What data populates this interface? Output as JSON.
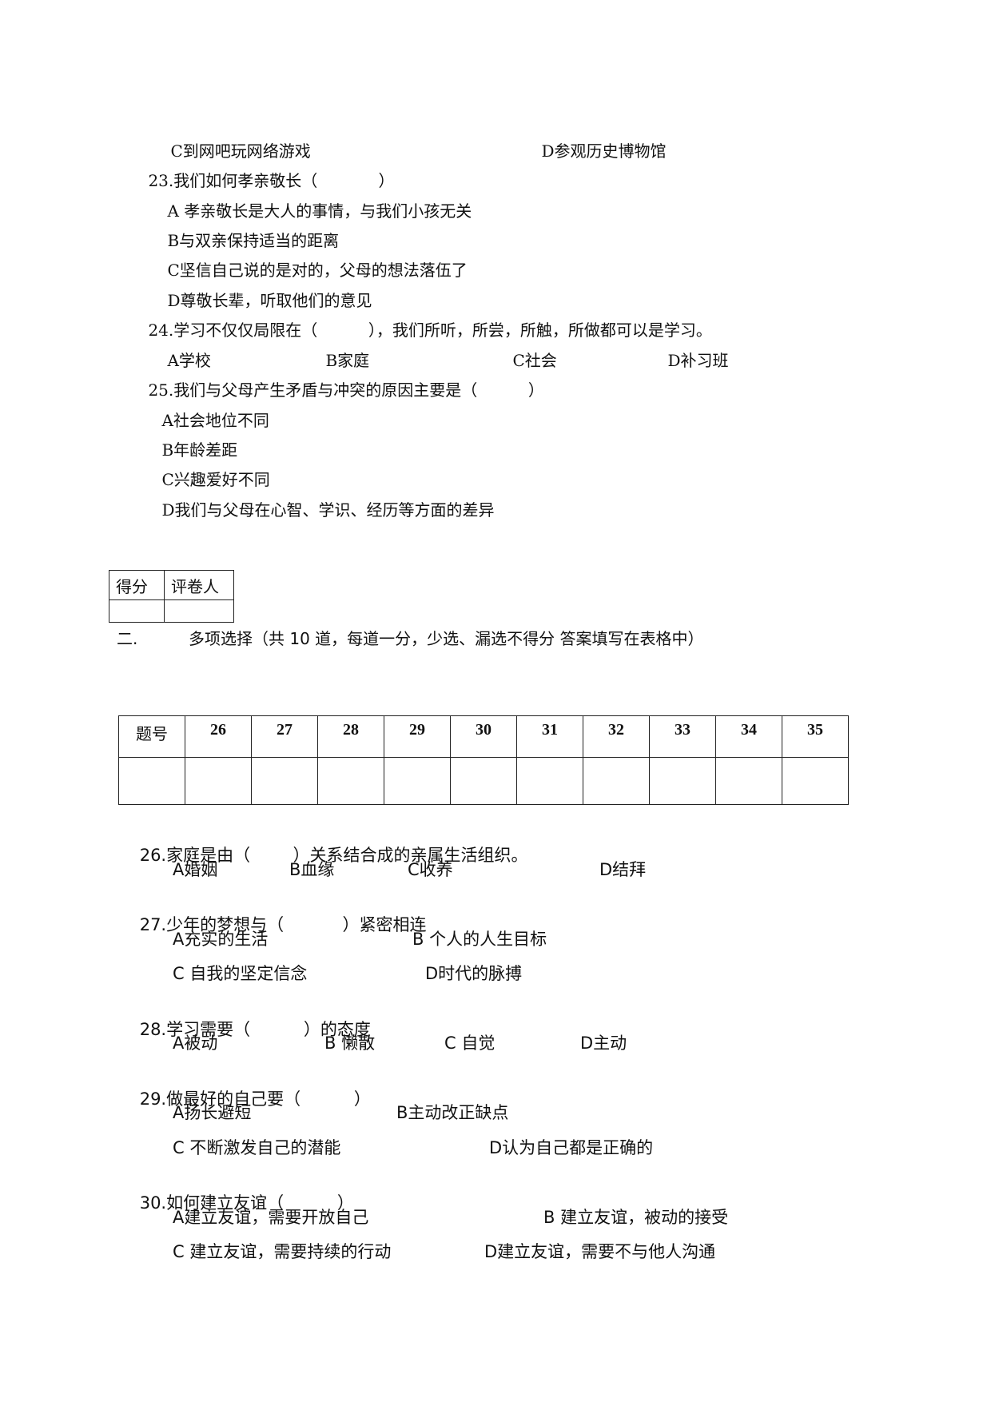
{
  "part1": {
    "q22_tail": {
      "options": [
        {
          "letter": "C",
          "text": "到网吧玩网络游戏"
        },
        {
          "letter": "D",
          "text": "参观历史博物馆"
        }
      ]
    },
    "questions": [
      {
        "number": "23.",
        "stem": "我们如何孝亲敬长（            ）",
        "options": [
          {
            "letter": "A",
            "text": "孝亲敬长是大人的事情，与我们小孩无关"
          },
          {
            "letter": "B",
            "text": "与双亲保持适当的距离"
          },
          {
            "letter": "C",
            "text": "坚信自己说的是对的，父母的想法落伍了"
          },
          {
            "letter": "D",
            "text": "尊敬长辈，听取他们的意见"
          }
        ]
      },
      {
        "number": "24.",
        "stem": "学习不仅仅局限在（          ），我们所听，所尝，所触，所做都可以是学习。",
        "options": [
          {
            "letter": "A",
            "text": "学校"
          },
          {
            "letter": "B",
            "text": "家庭"
          },
          {
            "letter": "C",
            "text": "社会"
          },
          {
            "letter": "D",
            "text": "补习班"
          }
        ]
      },
      {
        "number": "25.",
        "stem": "我们与父母产生矛盾与冲突的原因主要是（          ）",
        "options": [
          {
            "letter": "A",
            "text": "社会地位不同"
          },
          {
            "letter": "B",
            "text": "年龄差距"
          },
          {
            "letter": "C",
            "text": "兴趣爱好不同"
          },
          {
            "letter": "D",
            "text": "我们与父母在心智、学识、经历等方面的差异"
          }
        ]
      }
    ]
  },
  "score_table": {
    "headers": [
      "得分",
      "评卷人"
    ],
    "values": [
      "",
      ""
    ]
  },
  "section2": {
    "number": "二.",
    "title": "多项选择（共 10 道，每道一分，少选、漏选不得分 答案填写在表格中）"
  },
  "answer_table": {
    "header_label": "题号",
    "numbers": [
      "26",
      "27",
      "28",
      "29",
      "30",
      "31",
      "32",
      "33",
      "34",
      "35"
    ],
    "answers": [
      "",
      "",
      "",
      "",
      "",
      "",
      "",
      "",
      "",
      ""
    ]
  },
  "part2": {
    "questions": [
      {
        "number": "26.",
        "stem": "家庭是由（        ）关系结合成的亲属生活组织。",
        "options": [
          {
            "letter": "A",
            "text": "婚姻"
          },
          {
            "letter": "B",
            "text": "血缘"
          },
          {
            "letter": "C",
            "text": "收养"
          },
          {
            "letter": "D",
            "text": "结拜"
          }
        ]
      },
      {
        "number": "27.",
        "stem": "少年的梦想与（           ）紧密相连",
        "options": [
          {
            "letter": "A",
            "text": "充实的生活"
          },
          {
            "letter": "B",
            "text": "个人的人生目标"
          },
          {
            "letter": "C",
            "text": "自我的坚定信念"
          },
          {
            "letter": "D",
            "text": "时代的脉搏"
          }
        ]
      },
      {
        "number": "28.",
        "stem": "学习需要（          ）的态度",
        "options": [
          {
            "letter": "A",
            "text": "被动"
          },
          {
            "letter": "B",
            "text": "懒散"
          },
          {
            "letter": "C",
            "text": "自觉"
          },
          {
            "letter": "D",
            "text": "主动"
          }
        ]
      },
      {
        "number": "29.",
        "stem": "做最好的自己要（          ）",
        "options": [
          {
            "letter": "A",
            "text": "扬长避短"
          },
          {
            "letter": "B",
            "text": "主动改正缺点"
          },
          {
            "letter": "C",
            "text": "不断激发自己的潜能"
          },
          {
            "letter": "D",
            "text": "认为自己都是正确的"
          }
        ]
      },
      {
        "number": "30.",
        "stem": "如何建立友谊（          ）",
        "options": [
          {
            "letter": "A",
            "text": "建立友谊，需要开放自己"
          },
          {
            "letter": "B",
            "text": "建立友谊，被动的接受"
          },
          {
            "letter": "C",
            "text": "建立友谊，需要持续的行动"
          },
          {
            "letter": "D",
            "text": "建立友谊，需要不与他人沟通"
          }
        ]
      }
    ]
  }
}
